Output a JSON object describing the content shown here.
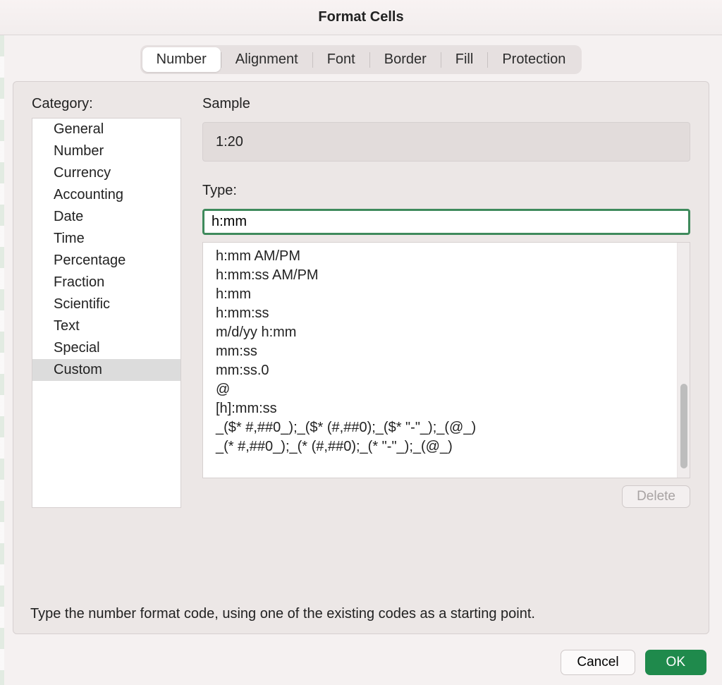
{
  "title": "Format Cells",
  "tabs": [
    "Number",
    "Alignment",
    "Font",
    "Border",
    "Fill",
    "Protection"
  ],
  "active_tab": 0,
  "category_label": "Category:",
  "categories": [
    "General",
    "Number",
    "Currency",
    "Accounting",
    "Date",
    "Time",
    "Percentage",
    "Fraction",
    "Scientific",
    "Text",
    "Special",
    "Custom"
  ],
  "selected_category_index": 11,
  "sample_label": "Sample",
  "sample_value": "1:20",
  "type_label": "Type:",
  "type_value": "h:mm",
  "format_codes": [
    "h:mm AM/PM",
    "h:mm:ss AM/PM",
    "h:mm",
    "h:mm:ss",
    "m/d/yy h:mm",
    "mm:ss",
    "mm:ss.0",
    "@",
    "[h]:mm:ss",
    "_($* #,##0_);_($* (#,##0);_($* \"-\"_);_(@_)",
    "_(* #,##0_);_(* (#,##0);_(* \"-\"_);_(@_)"
  ],
  "delete_label": "Delete",
  "hint": "Type the number format code, using one of the existing codes as a starting point.",
  "cancel_label": "Cancel",
  "ok_label": "OK"
}
